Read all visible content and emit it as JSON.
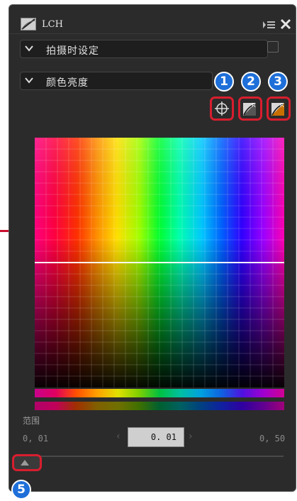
{
  "window": {
    "title": "LCH"
  },
  "sections": [
    {
      "label": "拍摄时设定"
    },
    {
      "label": "颜色亮度"
    }
  ],
  "callouts": [
    "1",
    "2",
    "3",
    "5"
  ],
  "range": {
    "label": "范围",
    "min": "0, 01",
    "max": "0, 50",
    "value": "0. 01",
    "decrease_arrow": "‹",
    "increase_arrow": "›"
  },
  "icons": {
    "titlebar": [
      "lch-tool-icon",
      "panel-menu-icon",
      "close-icon"
    ],
    "tools": [
      "crosshair-picker-icon",
      "reset-channel-icon",
      "reset-all-icon"
    ]
  },
  "colors": {
    "highlight": "#d81e2e",
    "callout": "#1e6fd9",
    "panel_bg": "#2b2b2b"
  },
  "chart_data": {
    "type": "line",
    "x": [
      0,
      1
    ],
    "series": [
      {
        "values": [
          0.5,
          0.5
        ]
      }
    ],
    "ylim": [
      0,
      1
    ],
    "xlim": [
      0,
      1
    ],
    "grid": true
  }
}
